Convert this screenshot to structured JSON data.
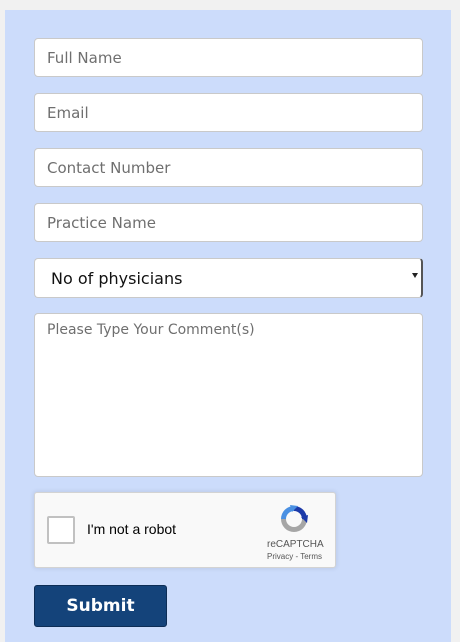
{
  "form": {
    "full_name": {
      "placeholder": "Full Name",
      "value": ""
    },
    "email": {
      "placeholder": "Email",
      "value": ""
    },
    "contact_number": {
      "placeholder": "Contact Number",
      "value": ""
    },
    "practice_name": {
      "placeholder": "Practice Name",
      "value": ""
    },
    "physicians_select": {
      "selected": "No of physicians"
    },
    "comments": {
      "placeholder": "Please Type Your Comment(s)",
      "value": ""
    },
    "submit_label": "Submit"
  },
  "recaptcha": {
    "label": "I'm not a robot",
    "brand": "reCAPTCHA",
    "privacy": "Privacy",
    "separator": " - ",
    "terms": "Terms",
    "checked": false
  },
  "colors": {
    "panel_background": "#ccdcfb",
    "submit_background": "#14437a",
    "recaptcha_blue": "#4a90e2",
    "recaptcha_dark_blue": "#1c3aa9",
    "recaptcha_gray": "#a6a6a6"
  },
  "icons": {
    "recaptcha_logo": "recaptcha-logo-icon",
    "select_arrow": "chevron-down-icon"
  }
}
